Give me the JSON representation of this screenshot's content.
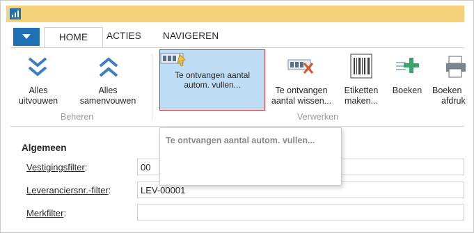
{
  "titlebar": {
    "app_icon": "app-logo-icon",
    "color": "#f5d27a"
  },
  "tabs": {
    "menu_icon": "dropdown-arrow-icon",
    "items": [
      {
        "label": "HOME",
        "active": true
      },
      {
        "label": "ACTIES",
        "active": false
      },
      {
        "label": "NAVIGEREN",
        "active": false
      }
    ]
  },
  "ribbon": {
    "groups": [
      {
        "label": "Beheren",
        "buttons": [
          {
            "icon": "expand-all-icon",
            "line1": "Alles",
            "line2": "uitvouwen"
          },
          {
            "icon": "collapse-all-icon",
            "line1": "Alles",
            "line2": "samenvouwen"
          }
        ]
      },
      {
        "label": "Verwerken",
        "buttons": [
          {
            "icon": "autofill-quantity-icon",
            "line1": "Te ontvangen aantal",
            "line2": "autom. vullen...",
            "selected": true
          },
          {
            "icon": "delete-quantity-icon",
            "line1": "Te ontvangen",
            "line2": "aantal wissen..."
          },
          {
            "icon": "barcode-labels-icon",
            "line1": "Etiketten",
            "line2": "maken..."
          },
          {
            "icon": "post-icon",
            "line1": "Boeken",
            "line2": ""
          },
          {
            "icon": "post-print-icon",
            "line1": "Boeken",
            "line2": "afdruk"
          }
        ]
      }
    ]
  },
  "tooltip": {
    "text": "Te ontvangen aantal autom. vullen..."
  },
  "form": {
    "section": "Algemeen",
    "fields": [
      {
        "label_pre": "Vestigingsfilter",
        "label_post": ":",
        "value": "00"
      },
      {
        "label_pre": "Leveranciersnr.-filter",
        "label_post": ":",
        "value": "LEV-00001"
      },
      {
        "label_pre": "Merkfilter",
        "label_post": ":",
        "value": ""
      }
    ]
  },
  "colors": {
    "accent": "#1f6fb4",
    "selected_bg": "#bfdcf5",
    "selected_border": "#d23a3a"
  }
}
